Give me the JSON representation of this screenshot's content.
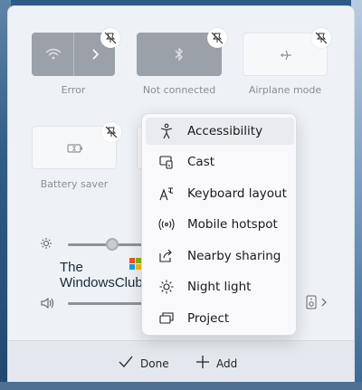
{
  "tiles": {
    "wifi": {
      "label": "Error"
    },
    "bluetooth": {
      "label": "Not connected"
    },
    "airplane": {
      "label": "Airplane mode"
    },
    "battery": {
      "label": "Battery saver"
    }
  },
  "watermark": {
    "line1": "The",
    "line2": "WindowsClub"
  },
  "add_menu": {
    "items": [
      {
        "label": "Accessibility",
        "icon": "accessibility-icon"
      },
      {
        "label": "Cast",
        "icon": "cast-icon"
      },
      {
        "label": "Keyboard layout",
        "icon": "keyboard-layout-icon"
      },
      {
        "label": "Mobile hotspot",
        "icon": "mobile-hotspot-icon"
      },
      {
        "label": "Nearby sharing",
        "icon": "nearby-sharing-icon"
      },
      {
        "label": "Night light",
        "icon": "night-light-icon"
      },
      {
        "label": "Project",
        "icon": "project-icon"
      }
    ]
  },
  "footer": {
    "done_label": "Done",
    "add_label": "Add"
  },
  "colors": {
    "tile_off": "#9aa1a8",
    "panel": "#eef1f5",
    "menu_bg": "#f9f9fb"
  }
}
